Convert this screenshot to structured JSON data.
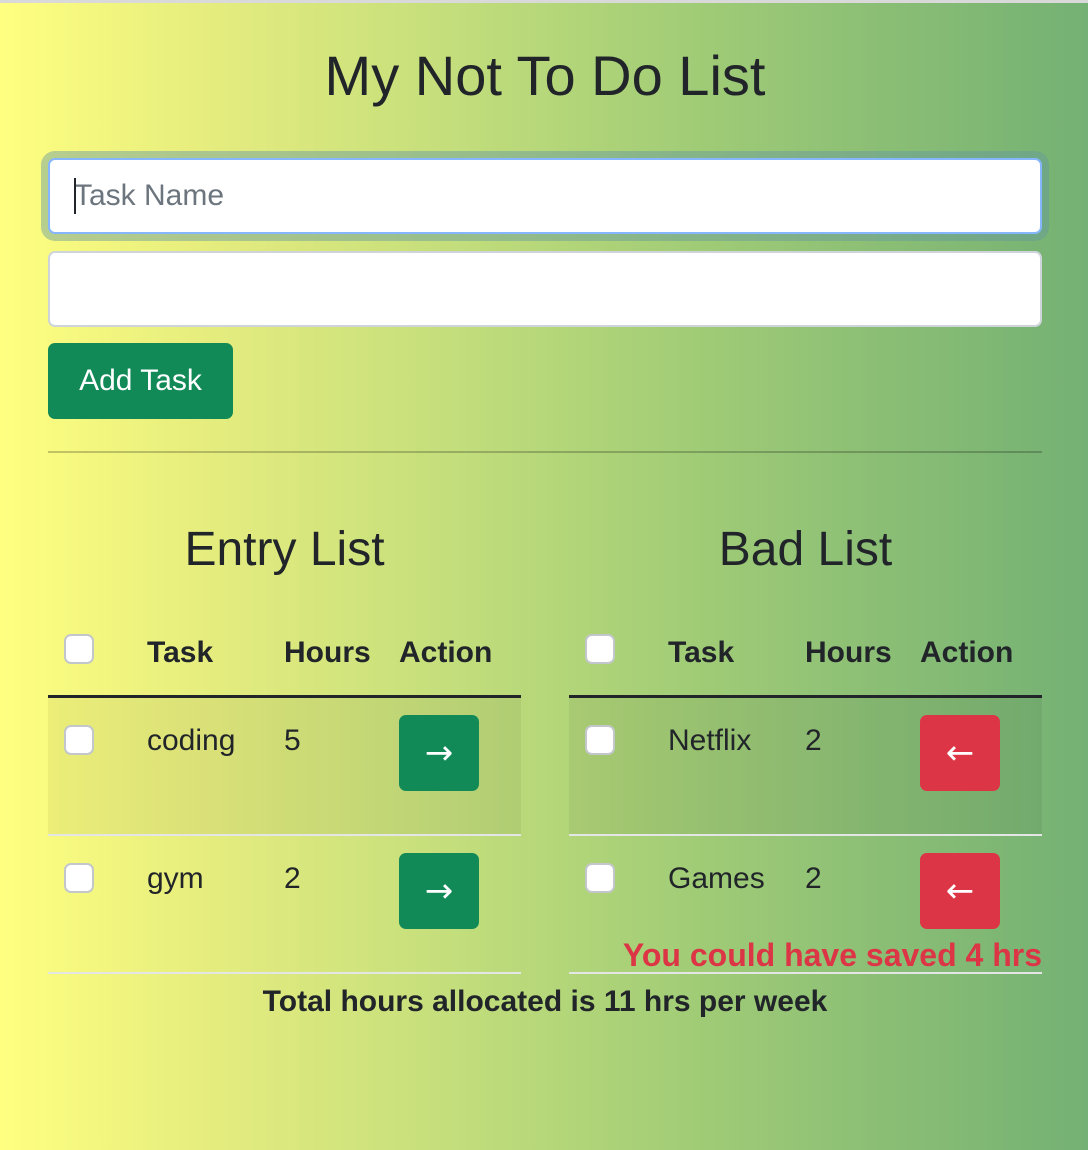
{
  "app": {
    "title": "My Not To Do List"
  },
  "form": {
    "task_name_placeholder": "Task Name",
    "task_name_value": "",
    "hours_value": "",
    "hours_placeholder": "",
    "add_button_label": "Add Task"
  },
  "entry_list": {
    "title": "Entry List",
    "headers": {
      "task": "Task",
      "hours": "Hours",
      "action": "Action"
    },
    "rows": [
      {
        "task": "coding",
        "hours": "5",
        "action_icon": "arrow-right-icon"
      },
      {
        "task": "gym",
        "hours": "2",
        "action_icon": "arrow-right-icon"
      }
    ],
    "action_glyph": "→",
    "action_color": "#128a58"
  },
  "bad_list": {
    "title": "Bad List",
    "headers": {
      "task": "Task",
      "hours": "Hours",
      "action": "Action"
    },
    "rows": [
      {
        "task": "Netflix",
        "hours": "2",
        "action_icon": "arrow-left-icon"
      },
      {
        "task": "Games",
        "hours": "2",
        "action_icon": "arrow-left-icon"
      }
    ],
    "action_glyph": "←",
    "action_color": "#dc3545"
  },
  "summary": {
    "saved_text": "You could have saved 4 hrs",
    "saved_color": "#dc3545",
    "total_text": "Total hours allocated is 11 hrs per week"
  },
  "theme": {
    "gradient_start": "#ffff80",
    "gradient_end": "#74b174",
    "primary_green": "#128a58",
    "danger_red": "#dc3545"
  }
}
